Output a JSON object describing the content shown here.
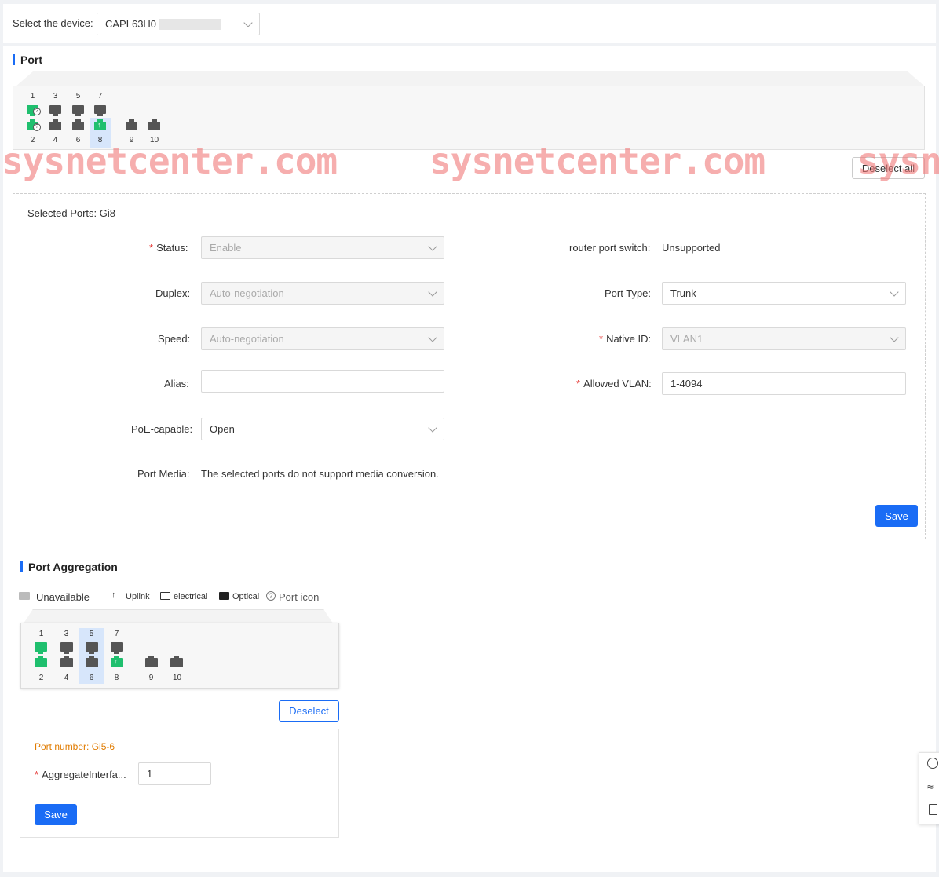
{
  "device": {
    "label": "Select the device:",
    "value": "CAPL63H0"
  },
  "port_section": {
    "title": "Port",
    "top_numbers": [
      "1",
      "3",
      "5",
      "7"
    ],
    "bottom_numbers": [
      "2",
      "4",
      "6",
      "8",
      "9",
      "10"
    ],
    "deselect_all": "Deselect all",
    "selected_ports": "Selected Ports: Gi8",
    "watermark": "sysnetcenter.com",
    "watermark_partial": "sysn"
  },
  "form": {
    "status": {
      "label": "Status:",
      "value": "Enable"
    },
    "duplex": {
      "label": "Duplex:",
      "value": "Auto-negotiation"
    },
    "speed": {
      "label": "Speed:",
      "value": "Auto-negotiation"
    },
    "alias": {
      "label": "Alias:",
      "value": ""
    },
    "poe": {
      "label": "PoE-capable:",
      "value": "Open"
    },
    "media": {
      "label": "Port Media:",
      "value": "The selected ports do not support media conversion."
    },
    "router_port": {
      "label": "router port switch:",
      "value": "Unsupported"
    },
    "port_type": {
      "label": "Port Type:",
      "value": "Trunk"
    },
    "native_id": {
      "label": "Native ID:",
      "value": "VLAN1"
    },
    "allowed_vlan": {
      "label": "Allowed VLAN:",
      "value": "1-4094"
    },
    "save": "Save"
  },
  "aggregation": {
    "title": "Port Aggregation",
    "legend": {
      "unavailable": "Unavailable",
      "uplink": "Uplink",
      "electrical": "electrical",
      "optical": "Optical",
      "port_icon": "Port icon"
    },
    "top_numbers": [
      "1",
      "3",
      "5",
      "7"
    ],
    "bottom_numbers": [
      "2",
      "4",
      "6",
      "8",
      "9",
      "10"
    ],
    "deselect": "Deselect",
    "port_number": "Port number: Gi5-6",
    "agg_label": "AggregateInterfa...",
    "agg_value": "1",
    "save": "Save"
  },
  "colors": {
    "accent": "#1a6cf5",
    "port_active": "#1fbf6e",
    "port_idle": "#555555",
    "required": "#e53935",
    "orange": "#e07b00"
  },
  "side_icons": [
    "chat-icon",
    "wave-icon",
    "clipboard-icon"
  ]
}
